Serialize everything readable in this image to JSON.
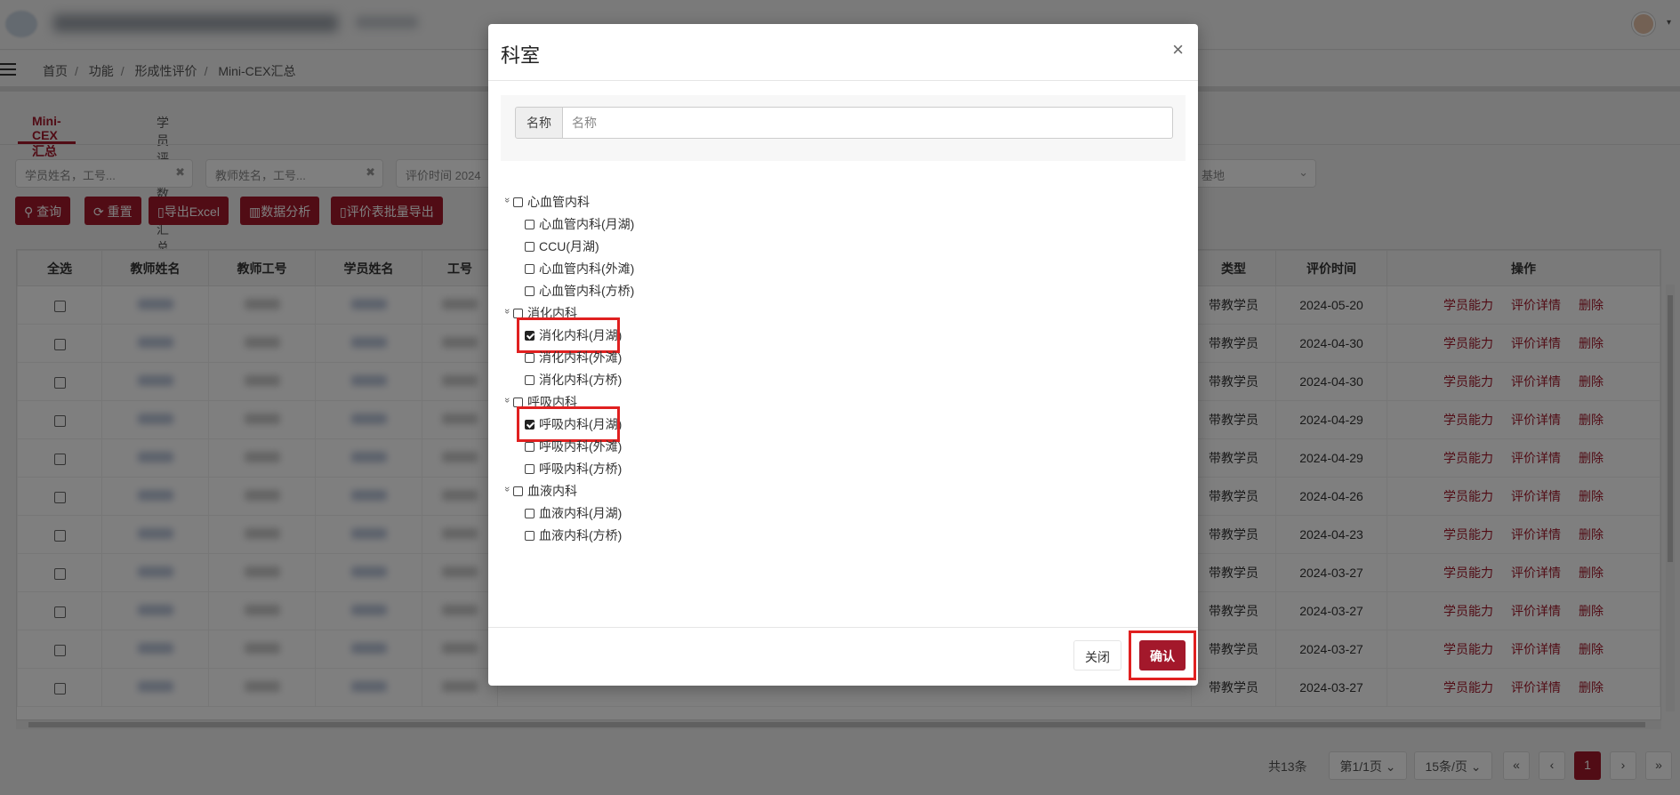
{
  "breadcrumb": [
    "首页",
    "功能",
    "形成性评价",
    "Mini-CEX汇总"
  ],
  "tabs": [
    {
      "label": "Mini-CEX汇总表",
      "active": true
    },
    {
      "label": "学员评价数量汇总表",
      "active": false
    }
  ],
  "filters": {
    "student_placeholder": "学员姓名，工号...",
    "teacher_placeholder": "教师姓名，工号...",
    "time_label": "评价时间",
    "time_value": "2024",
    "base_value": "基地"
  },
  "toolbar": {
    "query": "查询",
    "reset": "重置",
    "export_excel": "导出Excel",
    "analysis": "数据分析",
    "batch_export": "评价表批量导出"
  },
  "table": {
    "headers": [
      "全选",
      "教师姓名",
      "教师工号",
      "学员姓名",
      "工号",
      "类型",
      "评价时间",
      "操作"
    ],
    "rows": [
      {
        "type": "带教学员",
        "date": "2024-05-20"
      },
      {
        "type": "带教学员",
        "date": "2024-04-30"
      },
      {
        "type": "带教学员",
        "date": "2024-04-30"
      },
      {
        "type": "带教学员",
        "date": "2024-04-29"
      },
      {
        "type": "带教学员",
        "date": "2024-04-29"
      },
      {
        "type": "带教学员",
        "date": "2024-04-26"
      },
      {
        "type": "带教学员",
        "date": "2024-04-23"
      },
      {
        "type": "带教学员",
        "date": "2024-03-27"
      },
      {
        "type": "带教学员",
        "date": "2024-03-27"
      },
      {
        "type": "带教学员",
        "date": "2024-03-27"
      },
      {
        "type": "带教学员",
        "date": "2024-03-27"
      }
    ],
    "actions": [
      "学员能力",
      "评价详情",
      "删除"
    ]
  },
  "pager": {
    "total": "共13条",
    "page": "第1/1页",
    "page_size": "15条/页",
    "first": "«",
    "prev": "‹",
    "current": "1",
    "next": "›",
    "last": "»"
  },
  "modal": {
    "title": "科室",
    "close_x": "×",
    "search_label": "名称",
    "search_placeholder": "名称",
    "groups": [
      {
        "name": "心血管内科",
        "children": [
          {
            "name": "心血管内科(月湖)",
            "checked": false
          },
          {
            "name": "CCU(月湖)",
            "checked": false
          },
          {
            "name": "心血管内科(外滩)",
            "checked": false
          },
          {
            "name": "心血管内科(方桥)",
            "checked": false
          }
        ]
      },
      {
        "name": "消化内科",
        "children": [
          {
            "name": "消化内科(月湖)",
            "checked": true
          },
          {
            "name": "消化内科(外滩)",
            "checked": false
          },
          {
            "name": "消化内科(方桥)",
            "checked": false
          }
        ]
      },
      {
        "name": "呼吸内科",
        "children": [
          {
            "name": "呼吸内科(月湖)",
            "checked": true
          },
          {
            "name": "呼吸内科(外滩)",
            "checked": false
          },
          {
            "name": "呼吸内科(方桥)",
            "checked": false
          }
        ]
      },
      {
        "name": "血液内科",
        "children": [
          {
            "name": "血液内科(月湖)",
            "checked": false
          },
          {
            "name": "血液内科(方桥)",
            "checked": false
          }
        ]
      }
    ],
    "close_button": "关闭",
    "confirm_button": "确认"
  },
  "colors": {
    "accent": "#a3182b",
    "highlight": "#e02020"
  }
}
